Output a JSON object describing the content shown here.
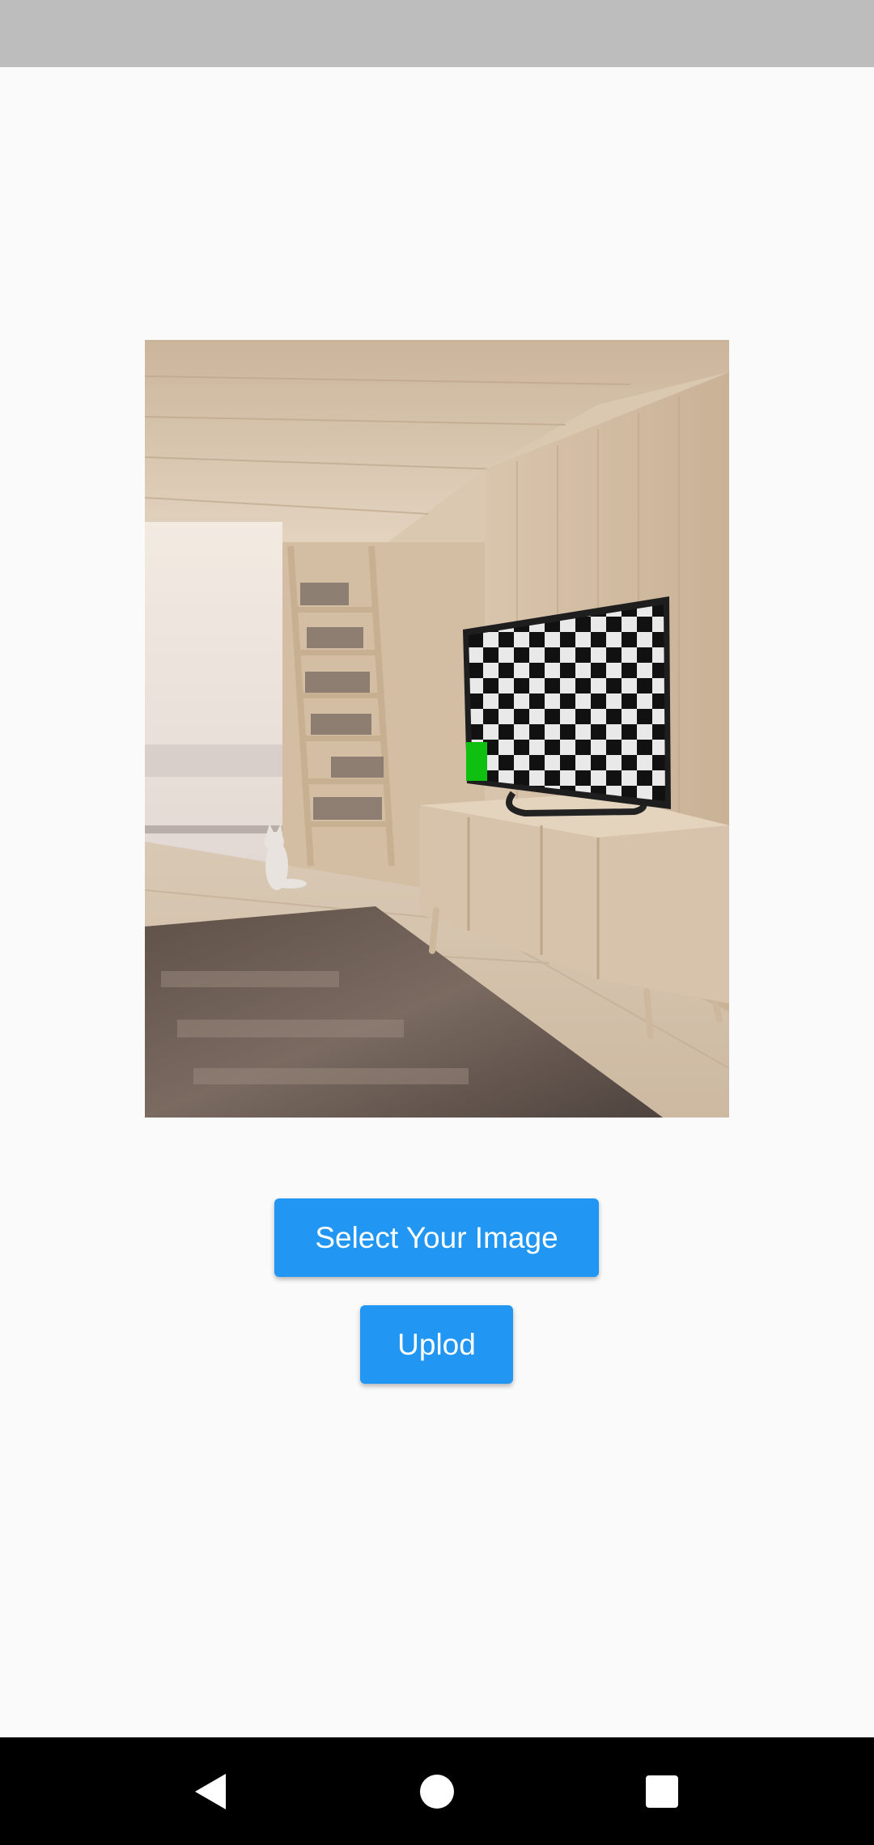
{
  "status_bar": {},
  "preview": {
    "icon": "room-photo-with-tv-checkerboard"
  },
  "buttons": {
    "select_label": "Select Your Image",
    "upload_label": "Uplod"
  },
  "colors": {
    "accent": "#2196F3",
    "background": "#FAFAFA",
    "status_bar": "#BDBDBD",
    "nav_bar": "#000000"
  },
  "nav": {
    "back_icon": "back-icon",
    "home_icon": "home-icon",
    "recents_icon": "recents-icon"
  }
}
